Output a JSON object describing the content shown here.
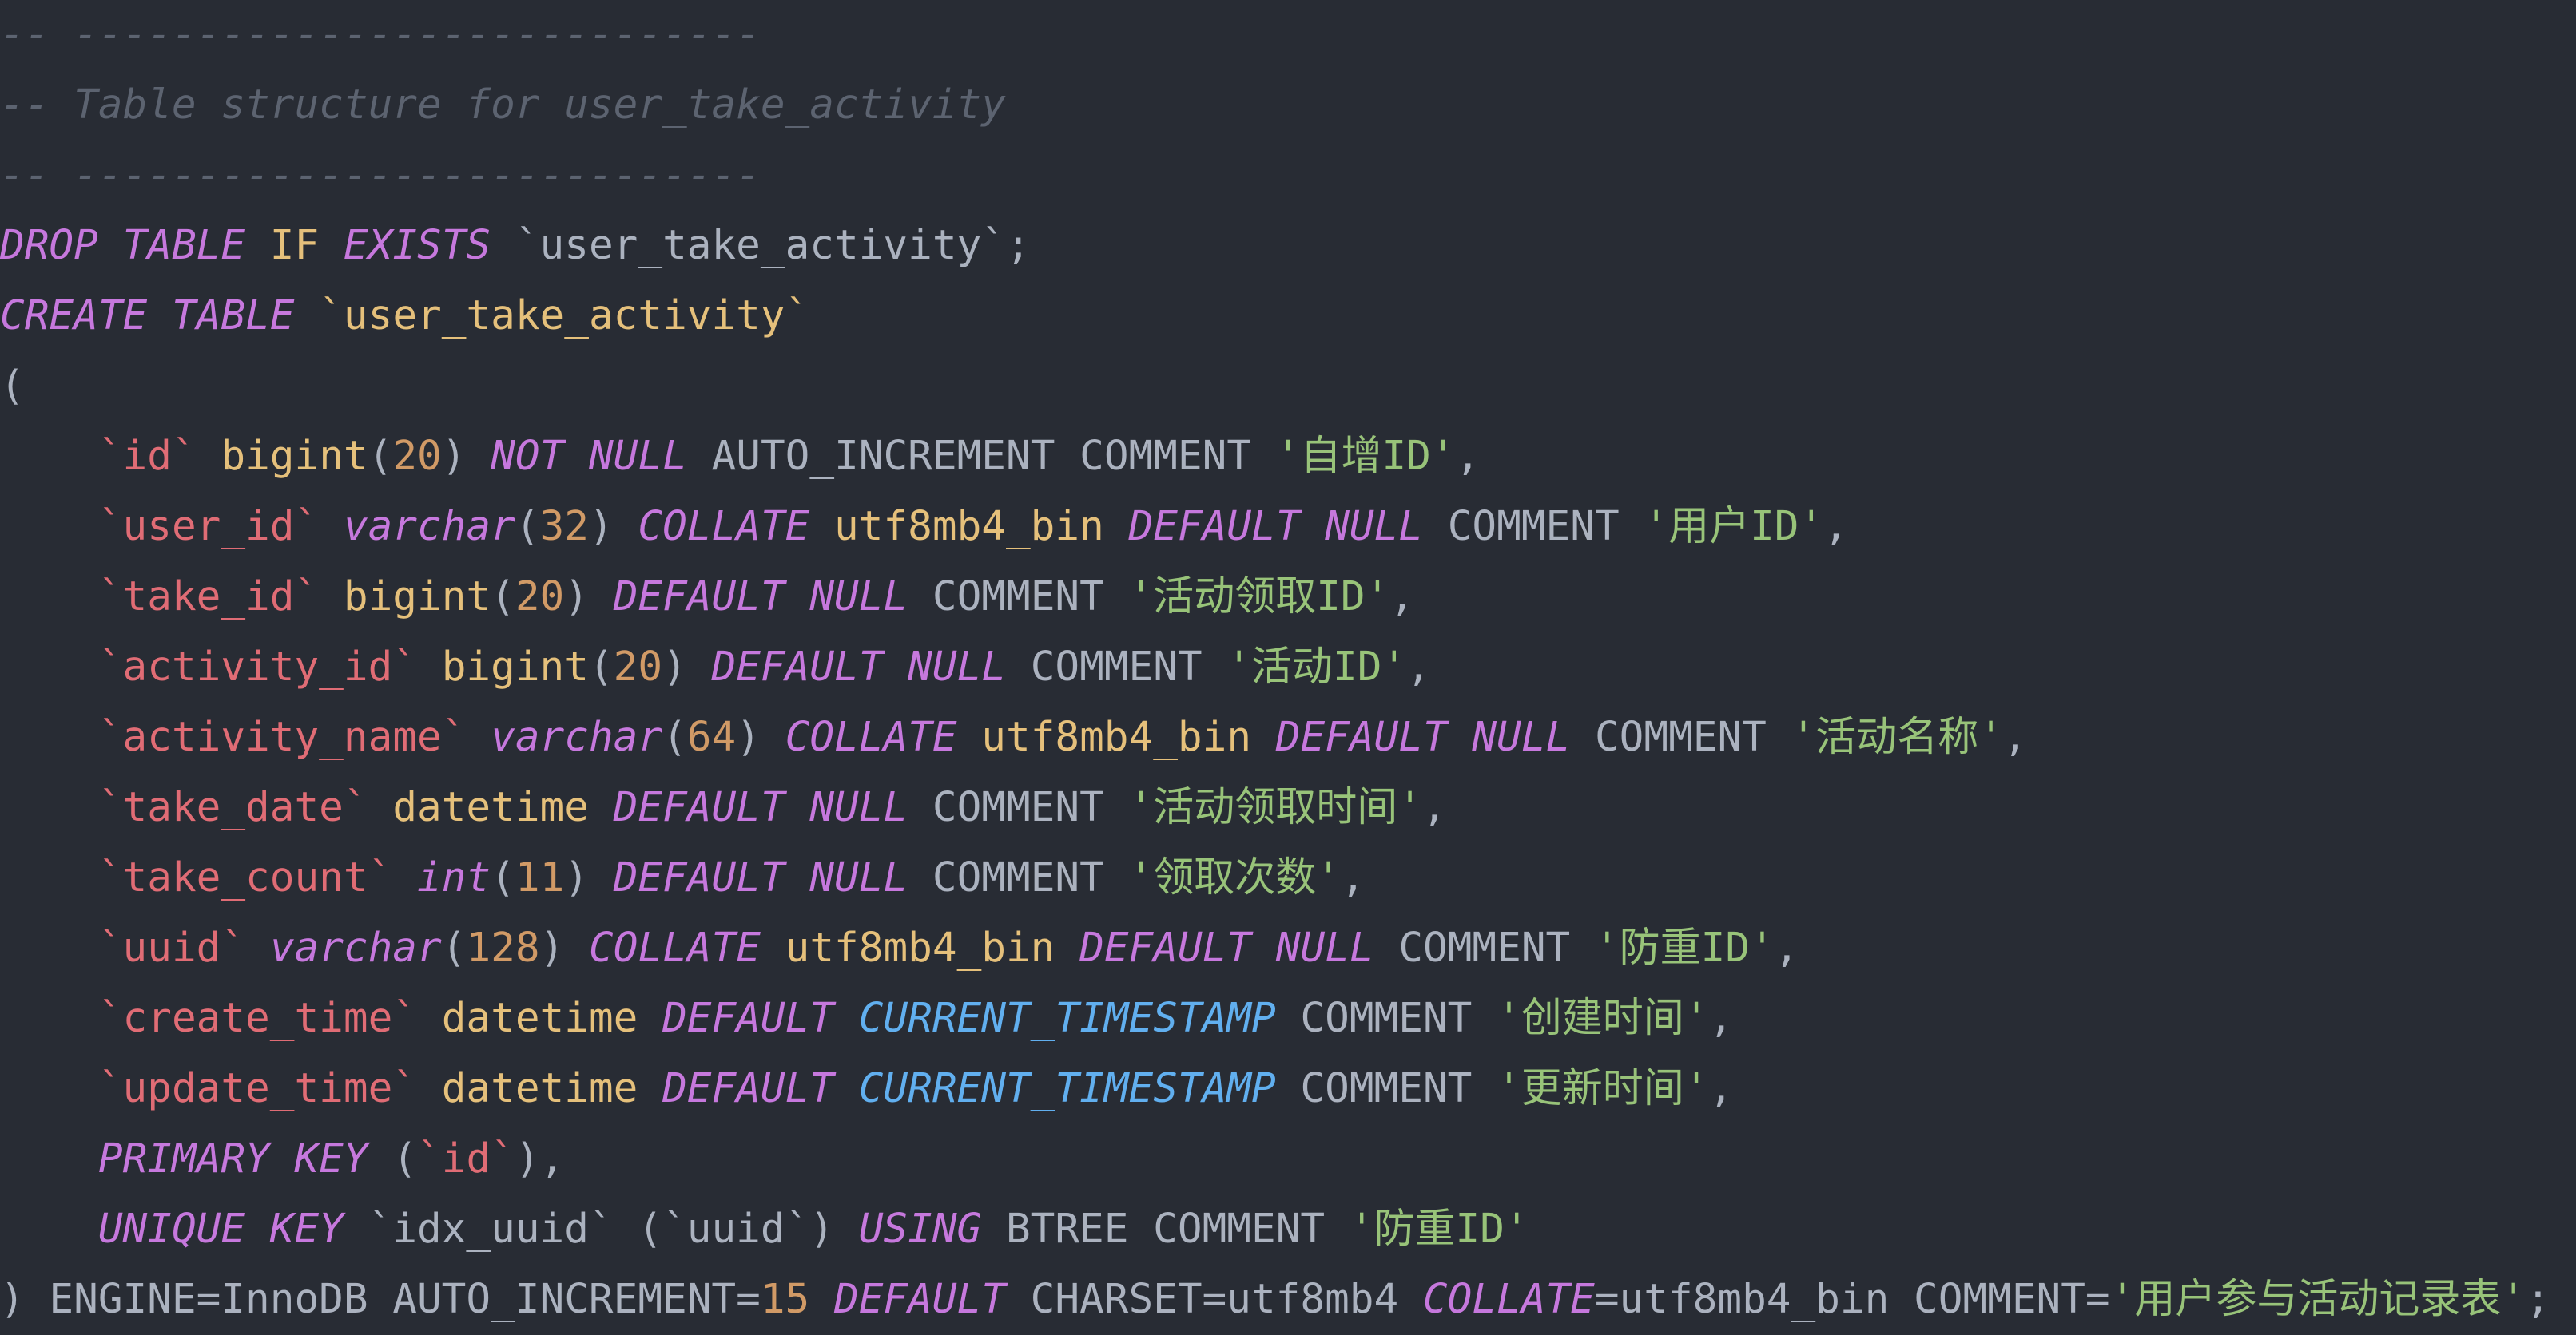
{
  "colors": {
    "background": "#282c34",
    "comment": "#5c6370",
    "keyword": "#c678dd",
    "plain": "#abb2bf",
    "table_name": "#e5c07b",
    "column_name": "#e06c75",
    "type": "#e5c07b",
    "number": "#d19a66",
    "string": "#98c379",
    "function": "#61afef"
  },
  "lines": [
    [
      {
        "t": "-- ----------------------------",
        "c": "comment"
      }
    ],
    [
      {
        "t": "-- Table structure for user_take_activity",
        "c": "comment"
      }
    ],
    [
      {
        "t": "-- ----------------------------",
        "c": "comment"
      }
    ],
    [
      {
        "t": "DROP",
        "c": "kw"
      },
      {
        "t": " ",
        "c": "pl"
      },
      {
        "t": "TABLE",
        "c": "kw"
      },
      {
        "t": " IF ",
        "c": "tbl"
      },
      {
        "t": "EXISTS",
        "c": "kw"
      },
      {
        "t": " `user_take_activity`;",
        "c": "pl"
      }
    ],
    [
      {
        "t": "CREATE",
        "c": "kw"
      },
      {
        "t": " ",
        "c": "pl"
      },
      {
        "t": "TABLE",
        "c": "kw"
      },
      {
        "t": " ",
        "c": "pl"
      },
      {
        "t": "`user_take_activity`",
        "c": "tbl"
      }
    ],
    [
      {
        "t": "(",
        "c": "pl"
      }
    ],
    [
      {
        "t": "    ",
        "c": "pl"
      },
      {
        "t": "`id`",
        "c": "col"
      },
      {
        "t": " ",
        "c": "pl"
      },
      {
        "t": "bigint",
        "c": "ty"
      },
      {
        "t": "(",
        "c": "pl"
      },
      {
        "t": "20",
        "c": "num"
      },
      {
        "t": ") ",
        "c": "pl"
      },
      {
        "t": "NOT",
        "c": "kw"
      },
      {
        "t": " ",
        "c": "pl"
      },
      {
        "t": "NULL",
        "c": "kw"
      },
      {
        "t": " AUTO_INCREMENT COMMENT ",
        "c": "pl"
      },
      {
        "t": "'自增ID'",
        "c": "str"
      },
      {
        "t": ",",
        "c": "pl"
      }
    ],
    [
      {
        "t": "    ",
        "c": "pl"
      },
      {
        "t": "`user_id`",
        "c": "col"
      },
      {
        "t": " ",
        "c": "pl"
      },
      {
        "t": "varchar",
        "c": "tyi"
      },
      {
        "t": "(",
        "c": "pl"
      },
      {
        "t": "32",
        "c": "num"
      },
      {
        "t": ") ",
        "c": "pl"
      },
      {
        "t": "COLLATE",
        "c": "kw"
      },
      {
        "t": " ",
        "c": "pl"
      },
      {
        "t": "utf8mb4_bin",
        "c": "ty"
      },
      {
        "t": " ",
        "c": "pl"
      },
      {
        "t": "DEFAULT",
        "c": "kw"
      },
      {
        "t": " ",
        "c": "pl"
      },
      {
        "t": "NULL",
        "c": "kw"
      },
      {
        "t": " COMMENT ",
        "c": "pl"
      },
      {
        "t": "'用户ID'",
        "c": "str"
      },
      {
        "t": ",",
        "c": "pl"
      }
    ],
    [
      {
        "t": "    ",
        "c": "pl"
      },
      {
        "t": "`take_id`",
        "c": "col"
      },
      {
        "t": " ",
        "c": "pl"
      },
      {
        "t": "bigint",
        "c": "ty"
      },
      {
        "t": "(",
        "c": "pl"
      },
      {
        "t": "20",
        "c": "num"
      },
      {
        "t": ") ",
        "c": "pl"
      },
      {
        "t": "DEFAULT",
        "c": "kw"
      },
      {
        "t": " ",
        "c": "pl"
      },
      {
        "t": "NULL",
        "c": "kw"
      },
      {
        "t": " COMMENT ",
        "c": "pl"
      },
      {
        "t": "'活动领取ID'",
        "c": "str"
      },
      {
        "t": ",",
        "c": "pl"
      }
    ],
    [
      {
        "t": "    ",
        "c": "pl"
      },
      {
        "t": "`activity_id`",
        "c": "col"
      },
      {
        "t": " ",
        "c": "pl"
      },
      {
        "t": "bigint",
        "c": "ty"
      },
      {
        "t": "(",
        "c": "pl"
      },
      {
        "t": "20",
        "c": "num"
      },
      {
        "t": ") ",
        "c": "pl"
      },
      {
        "t": "DEFAULT",
        "c": "kw"
      },
      {
        "t": " ",
        "c": "pl"
      },
      {
        "t": "NULL",
        "c": "kw"
      },
      {
        "t": " COMMENT ",
        "c": "pl"
      },
      {
        "t": "'活动ID'",
        "c": "str"
      },
      {
        "t": ",",
        "c": "pl"
      }
    ],
    [
      {
        "t": "    ",
        "c": "pl"
      },
      {
        "t": "`activity_name`",
        "c": "col"
      },
      {
        "t": " ",
        "c": "pl"
      },
      {
        "t": "varchar",
        "c": "tyi"
      },
      {
        "t": "(",
        "c": "pl"
      },
      {
        "t": "64",
        "c": "num"
      },
      {
        "t": ") ",
        "c": "pl"
      },
      {
        "t": "COLLATE",
        "c": "kw"
      },
      {
        "t": " ",
        "c": "pl"
      },
      {
        "t": "utf8mb4_bin",
        "c": "ty"
      },
      {
        "t": " ",
        "c": "pl"
      },
      {
        "t": "DEFAULT",
        "c": "kw"
      },
      {
        "t": " ",
        "c": "pl"
      },
      {
        "t": "NULL",
        "c": "kw"
      },
      {
        "t": " COMMENT ",
        "c": "pl"
      },
      {
        "t": "'活动名称'",
        "c": "str"
      },
      {
        "t": ",",
        "c": "pl"
      }
    ],
    [
      {
        "t": "    ",
        "c": "pl"
      },
      {
        "t": "`take_date`",
        "c": "col"
      },
      {
        "t": " ",
        "c": "pl"
      },
      {
        "t": "datetime",
        "c": "ty"
      },
      {
        "t": " ",
        "c": "pl"
      },
      {
        "t": "DEFAULT",
        "c": "kw"
      },
      {
        "t": " ",
        "c": "pl"
      },
      {
        "t": "NULL",
        "c": "kw"
      },
      {
        "t": " COMMENT ",
        "c": "pl"
      },
      {
        "t": "'活动领取时间'",
        "c": "str"
      },
      {
        "t": ",",
        "c": "pl"
      }
    ],
    [
      {
        "t": "    ",
        "c": "pl"
      },
      {
        "t": "`take_count`",
        "c": "col"
      },
      {
        "t": " ",
        "c": "pl"
      },
      {
        "t": "int",
        "c": "tyi"
      },
      {
        "t": "(",
        "c": "pl"
      },
      {
        "t": "11",
        "c": "num"
      },
      {
        "t": ") ",
        "c": "pl"
      },
      {
        "t": "DEFAULT",
        "c": "kw"
      },
      {
        "t": " ",
        "c": "pl"
      },
      {
        "t": "NULL",
        "c": "kw"
      },
      {
        "t": " COMMENT ",
        "c": "pl"
      },
      {
        "t": "'领取次数'",
        "c": "str"
      },
      {
        "t": ",",
        "c": "pl"
      }
    ],
    [
      {
        "t": "    ",
        "c": "pl"
      },
      {
        "t": "`uuid`",
        "c": "col"
      },
      {
        "t": " ",
        "c": "pl"
      },
      {
        "t": "varchar",
        "c": "tyi"
      },
      {
        "t": "(",
        "c": "pl"
      },
      {
        "t": "128",
        "c": "num"
      },
      {
        "t": ") ",
        "c": "pl"
      },
      {
        "t": "COLLATE",
        "c": "kw"
      },
      {
        "t": " ",
        "c": "pl"
      },
      {
        "t": "utf8mb4_bin",
        "c": "ty"
      },
      {
        "t": " ",
        "c": "pl"
      },
      {
        "t": "DEFAULT",
        "c": "kw"
      },
      {
        "t": " ",
        "c": "pl"
      },
      {
        "t": "NULL",
        "c": "kw"
      },
      {
        "t": " COMMENT ",
        "c": "pl"
      },
      {
        "t": "'防重ID'",
        "c": "str"
      },
      {
        "t": ",",
        "c": "pl"
      }
    ],
    [
      {
        "t": "    ",
        "c": "pl"
      },
      {
        "t": "`create_time`",
        "c": "col"
      },
      {
        "t": " ",
        "c": "pl"
      },
      {
        "t": "datetime",
        "c": "ty"
      },
      {
        "t": " ",
        "c": "pl"
      },
      {
        "t": "DEFAULT",
        "c": "kw"
      },
      {
        "t": " ",
        "c": "pl"
      },
      {
        "t": "CURRENT_TIMESTAMP",
        "c": "fn"
      },
      {
        "t": " COMMENT ",
        "c": "pl"
      },
      {
        "t": "'创建时间'",
        "c": "str"
      },
      {
        "t": ",",
        "c": "pl"
      }
    ],
    [
      {
        "t": "    ",
        "c": "pl"
      },
      {
        "t": "`update_time`",
        "c": "col"
      },
      {
        "t": " ",
        "c": "pl"
      },
      {
        "t": "datetime",
        "c": "ty"
      },
      {
        "t": " ",
        "c": "pl"
      },
      {
        "t": "DEFAULT",
        "c": "kw"
      },
      {
        "t": " ",
        "c": "pl"
      },
      {
        "t": "CURRENT_TIMESTAMP",
        "c": "fn"
      },
      {
        "t": " COMMENT ",
        "c": "pl"
      },
      {
        "t": "'更新时间'",
        "c": "str"
      },
      {
        "t": ",",
        "c": "pl"
      }
    ],
    [
      {
        "t": "    ",
        "c": "pl"
      },
      {
        "t": "PRIMARY",
        "c": "kw"
      },
      {
        "t": " ",
        "c": "pl"
      },
      {
        "t": "KEY",
        "c": "kw"
      },
      {
        "t": " (",
        "c": "pl"
      },
      {
        "t": "`id`",
        "c": "col"
      },
      {
        "t": "),",
        "c": "pl"
      }
    ],
    [
      {
        "t": "    ",
        "c": "pl"
      },
      {
        "t": "UNIQUE",
        "c": "kw"
      },
      {
        "t": " ",
        "c": "pl"
      },
      {
        "t": "KEY",
        "c": "kw"
      },
      {
        "t": " `idx_uuid` (`uuid`) ",
        "c": "pl"
      },
      {
        "t": "USING",
        "c": "kw"
      },
      {
        "t": " BTREE COMMENT ",
        "c": "pl"
      },
      {
        "t": "'防重ID'",
        "c": "str"
      }
    ],
    [
      {
        "t": ") ENGINE=InnoDB AUTO_INCREMENT=",
        "c": "pl"
      },
      {
        "t": "15",
        "c": "num"
      },
      {
        "t": " ",
        "c": "pl"
      },
      {
        "t": "DEFAULT",
        "c": "kw"
      },
      {
        "t": " CHARSET=utf8mb4 ",
        "c": "pl"
      },
      {
        "t": "COLLATE",
        "c": "kw"
      },
      {
        "t": "=utf8mb4_bin COMMENT=",
        "c": "pl"
      },
      {
        "t": "'用户参与活动记录表'",
        "c": "str"
      },
      {
        "t": ";",
        "c": "pl"
      }
    ]
  ]
}
